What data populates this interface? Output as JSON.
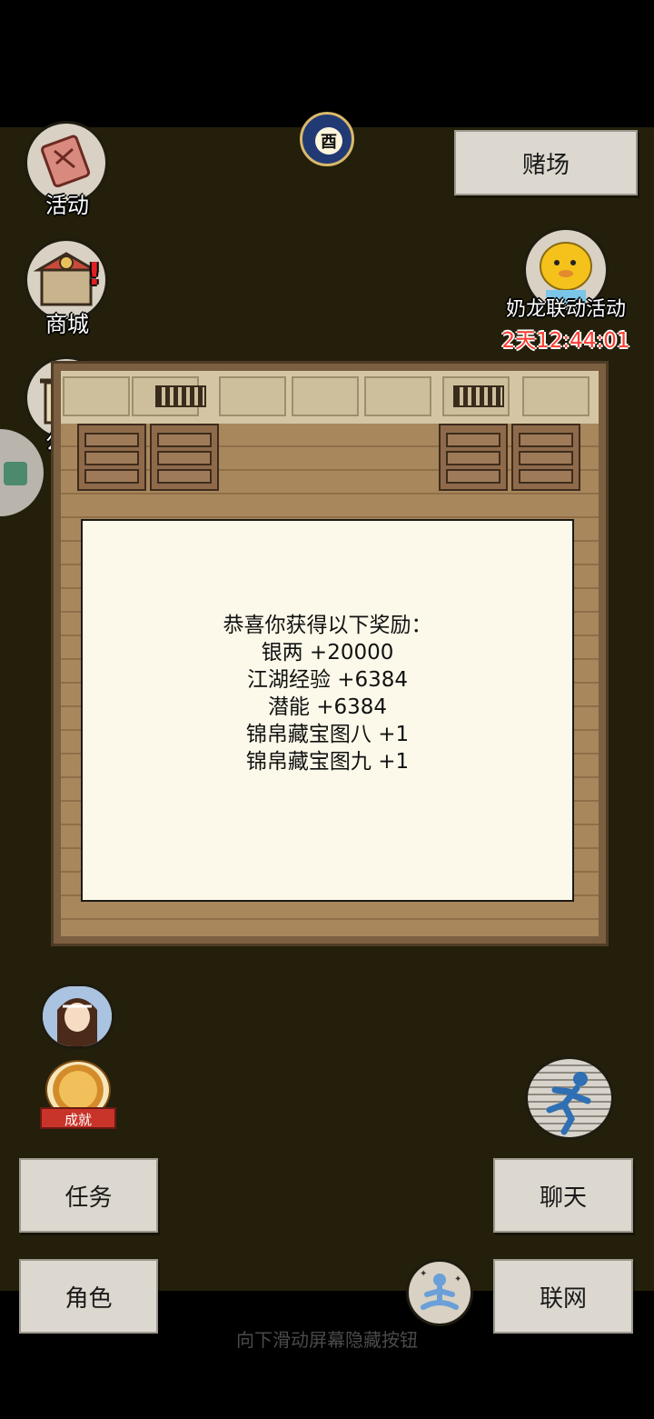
{
  "top_bar": {
    "time_icon_char": "酉",
    "casino_label": "赌场"
  },
  "left_menu": {
    "activity_label": "活动",
    "shop_label": "商城",
    "notice_label": "公告"
  },
  "event": {
    "title": "奶龙联动活动",
    "countdown": "2天12:44:01"
  },
  "reward": {
    "heading": "恭喜你获得以下奖励：",
    "items": [
      "银两 +20000",
      "江湖经验 +6384",
      "潜能 +6384",
      "锦帛藏宝图八 +1",
      "锦帛藏宝图九 +1"
    ]
  },
  "bottom": {
    "achievement_badge": "成就",
    "task_label": "任务",
    "role_label": "角色",
    "chat_label": "聊天",
    "network_label": "联网",
    "hint": "向下滑动屏幕隐藏按钮"
  },
  "colors": {
    "scene_bg": "#231f0a",
    "paper": "#fdf9ea",
    "timer_red": "#ff3b30"
  }
}
